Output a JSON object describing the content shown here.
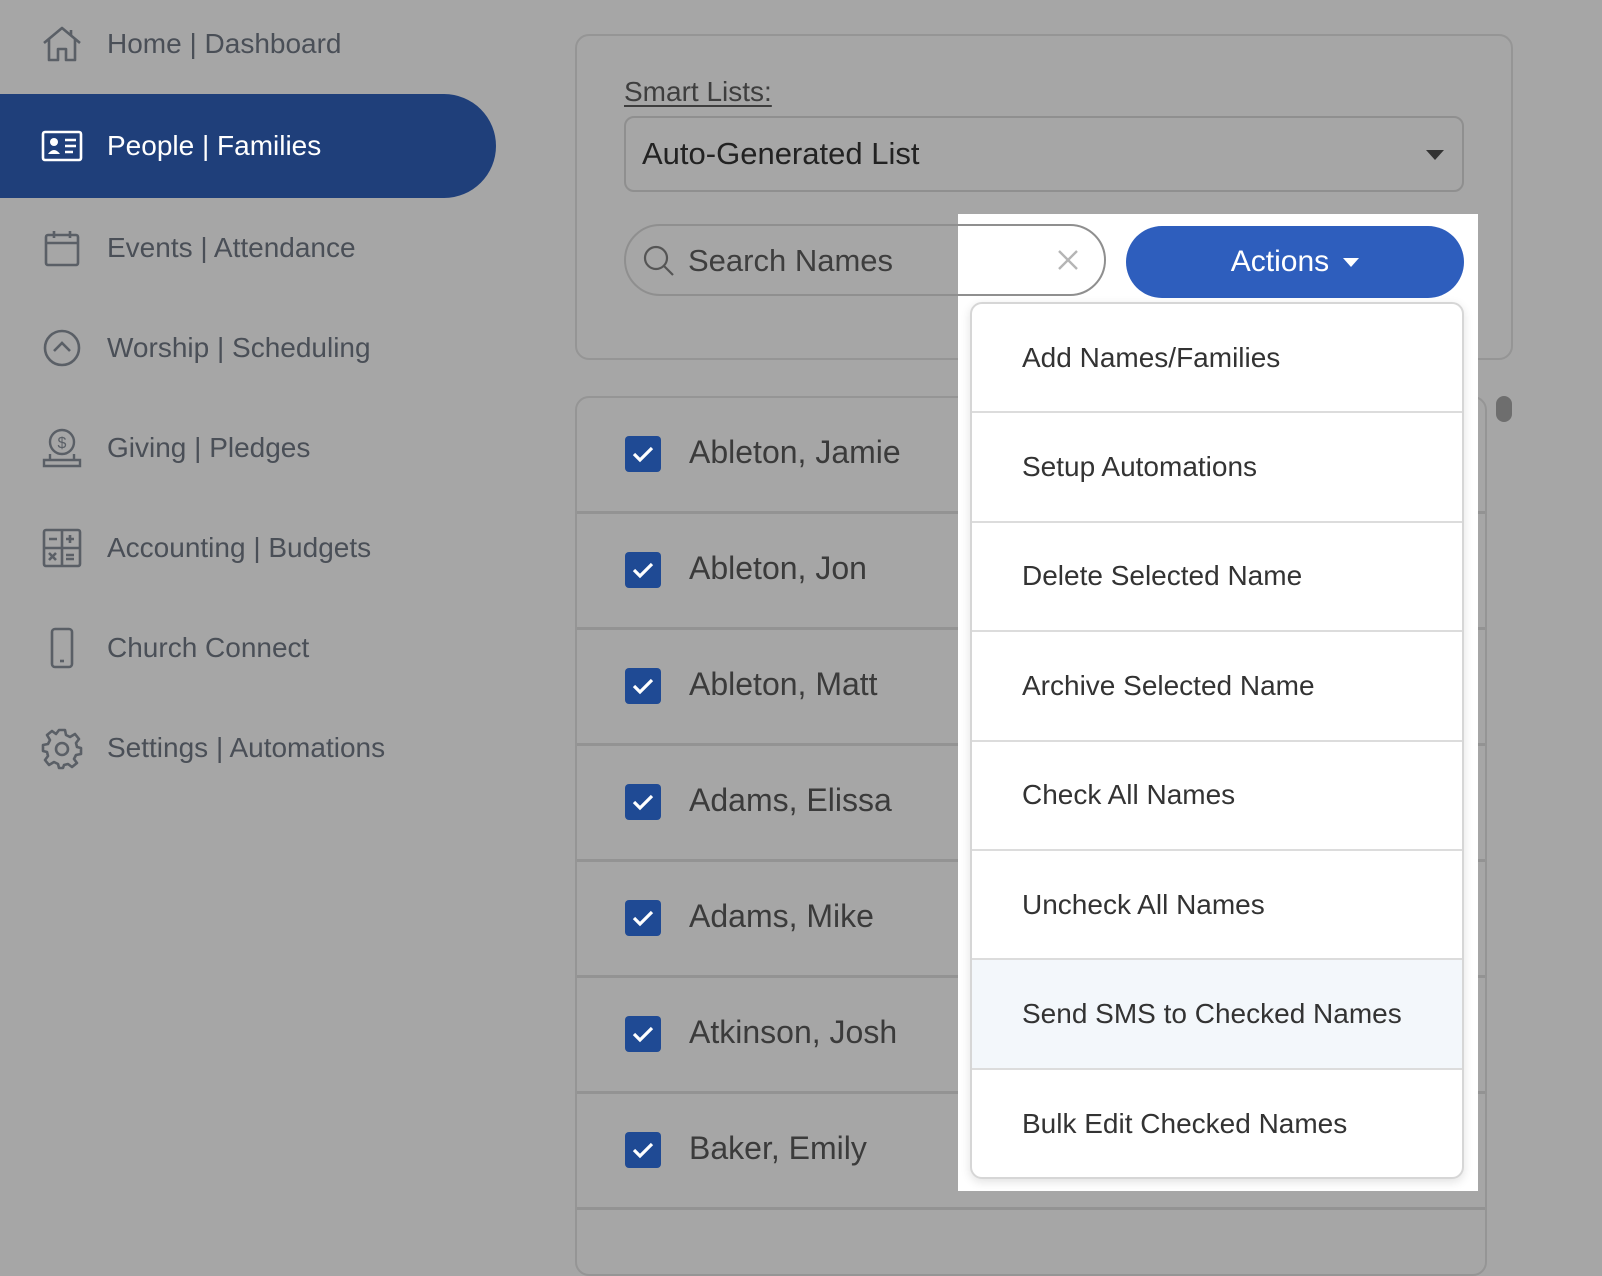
{
  "sidebar": {
    "items": [
      {
        "label": "Home | Dashboard",
        "icon": "home-icon"
      },
      {
        "label": "People | Families",
        "icon": "contact-card-icon",
        "active": true
      },
      {
        "label": "Events | Attendance",
        "icon": "calendar-icon"
      },
      {
        "label": "Worship | Scheduling",
        "icon": "chevron-up-circle-icon"
      },
      {
        "label": "Giving | Pledges",
        "icon": "donation-icon"
      },
      {
        "label": "Accounting | Budgets",
        "icon": "calculator-icon"
      },
      {
        "label": "Church Connect",
        "icon": "mobile-phone-icon"
      },
      {
        "label": "Settings | Automations",
        "icon": "gear-icon"
      }
    ]
  },
  "smart_lists": {
    "label": "Smart Lists:",
    "selected": "Auto-Generated List"
  },
  "search": {
    "placeholder": "Search Names",
    "value": ""
  },
  "actions": {
    "label": "Actions",
    "menu": [
      "Add Names/Families",
      "Setup Automations",
      "Delete Selected Name",
      "Archive Selected Name",
      "Check All Names",
      "Uncheck All Names",
      "Send SMS to Checked Names",
      "Bulk Edit Checked Names"
    ]
  },
  "names": [
    {
      "name": "Ableton, Jamie",
      "checked": true
    },
    {
      "name": "Ableton, Jon",
      "checked": true
    },
    {
      "name": "Ableton, Matt",
      "checked": true
    },
    {
      "name": "Adams, Elissa",
      "checked": true
    },
    {
      "name": "Adams, Mike",
      "checked": true
    },
    {
      "name": "Atkinson, Josh",
      "checked": true
    },
    {
      "name": "Baker, Emily",
      "checked": true
    }
  ],
  "colors": {
    "active_nav": "#1f3f7a",
    "actions_button": "#2e5ebd",
    "checkbox": "#1f4a94"
  }
}
